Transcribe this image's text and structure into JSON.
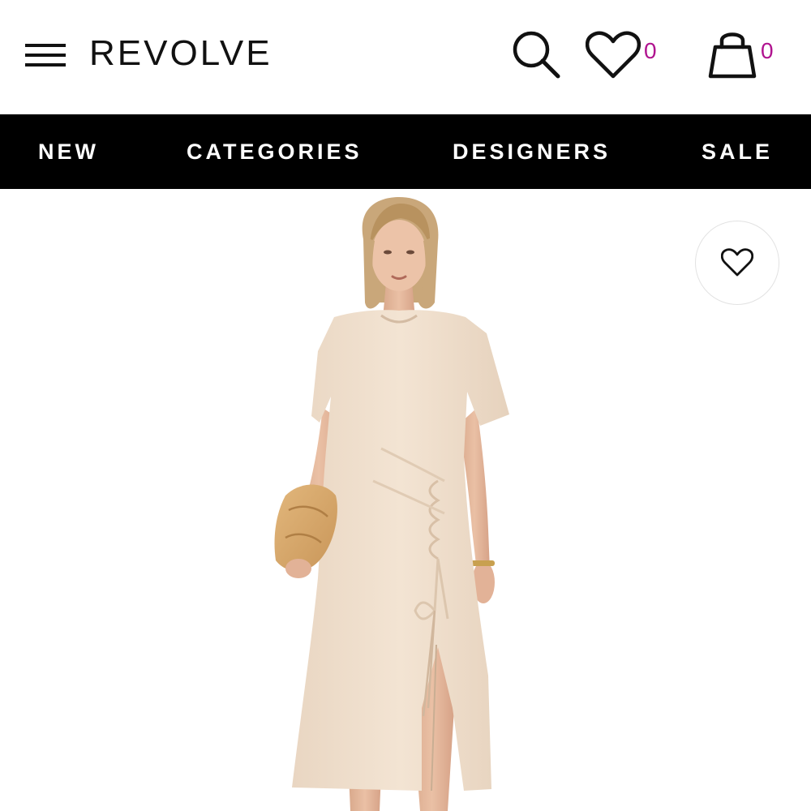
{
  "header": {
    "logo": "REVOLVE",
    "wishlist_count": "0",
    "bag_count": "0",
    "icons": {
      "menu": "hamburger-menu-icon",
      "search": "search-icon",
      "wishlist": "heart-icon",
      "bag": "shopping-bag-icon"
    },
    "count_color": "#b0138f"
  },
  "nav": {
    "items": [
      {
        "label": "NEW"
      },
      {
        "label": "CATEGORIES"
      },
      {
        "label": "DESIGNERS"
      },
      {
        "label": "SALE"
      }
    ],
    "background": "#000000"
  },
  "product": {
    "image_description_icon": "product-photo",
    "dress_color": "#f0e0cf",
    "favorite_icon": "heart-icon"
  }
}
